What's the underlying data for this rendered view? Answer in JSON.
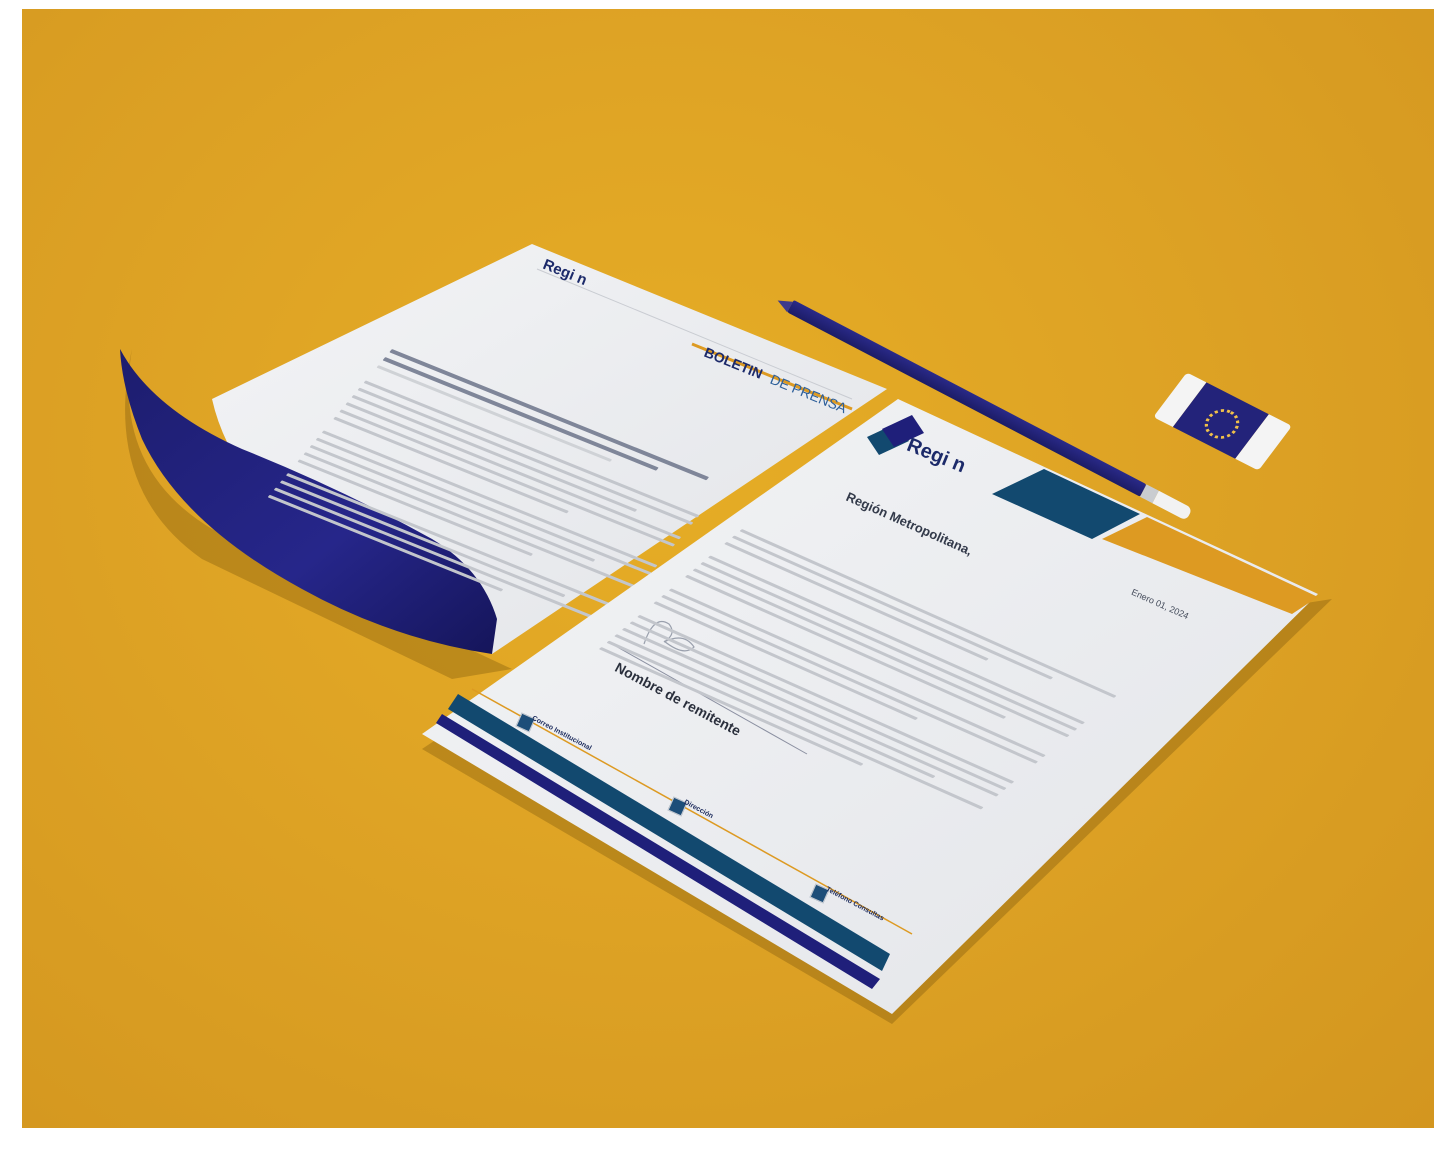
{
  "colors": {
    "background": "#dea325",
    "navy": "#1f1f7a",
    "teal_blue": "#12496f",
    "gold": "#dd9a22",
    "paper": "#eeeff1"
  },
  "press_release": {
    "logo": "Regi n",
    "header": {
      "boletin": "BOLETIN",
      "de_prensa": "DE PRENSA"
    }
  },
  "letterhead": {
    "logo_word": "Regi n",
    "greeting": "Región Metropolitana,",
    "date": "Enero 01, 2024",
    "signature": {
      "name": "Nombre de remitente"
    },
    "footer": {
      "contacts": [
        {
          "icon": "email-icon",
          "title": "Correo Institucional"
        },
        {
          "icon": "location-icon",
          "title": "Dirección"
        },
        {
          "icon": "phone-icon",
          "title": "Teléfono Consultas"
        }
      ]
    }
  },
  "pencil": {
    "icon": "pencil-icon"
  },
  "eraser": {
    "icon": "eraser-icon"
  }
}
